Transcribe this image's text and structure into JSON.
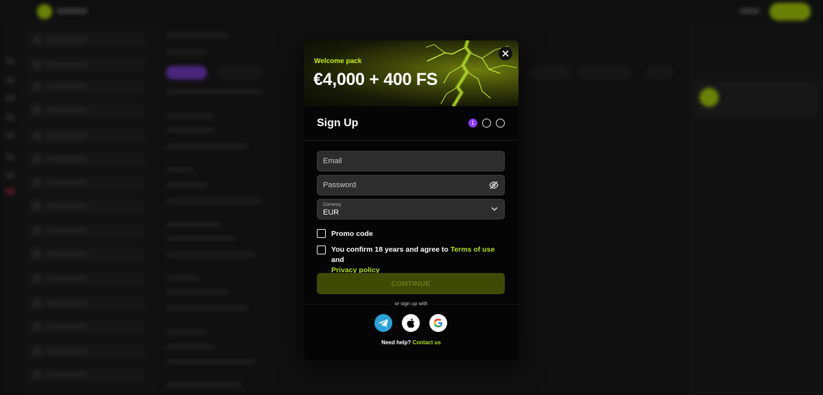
{
  "banner": {
    "kicker": "Welcome pack",
    "title": "€4,000 + 400 FS"
  },
  "form": {
    "title": "Sign Up",
    "steps": [
      "1",
      "",
      ""
    ],
    "email_placeholder": "Email",
    "password_placeholder": "Password",
    "currency_label": "Currency",
    "currency_value": "EUR",
    "promo_label": "Promo code",
    "confirm_prefix": "You confirm 18 years and agree to ",
    "terms_link": "Terms of use",
    "confirm_and": " and",
    "privacy_link": "Privacy policy",
    "continue_label": "CONTINUE",
    "or_label": "or sign up with",
    "help_prefix": "Need help? ",
    "help_link": "Contact us"
  },
  "social": [
    {
      "name": "telegram-icon",
      "color": "#2aa3dd"
    },
    {
      "name": "apple-icon",
      "color": "#ffffff"
    },
    {
      "name": "google-icon",
      "color": "#ffffff"
    }
  ],
  "colors": {
    "accent": "#b5e31a",
    "step_active": "#8b3cf6",
    "cta_bg": "#3f4a05"
  }
}
